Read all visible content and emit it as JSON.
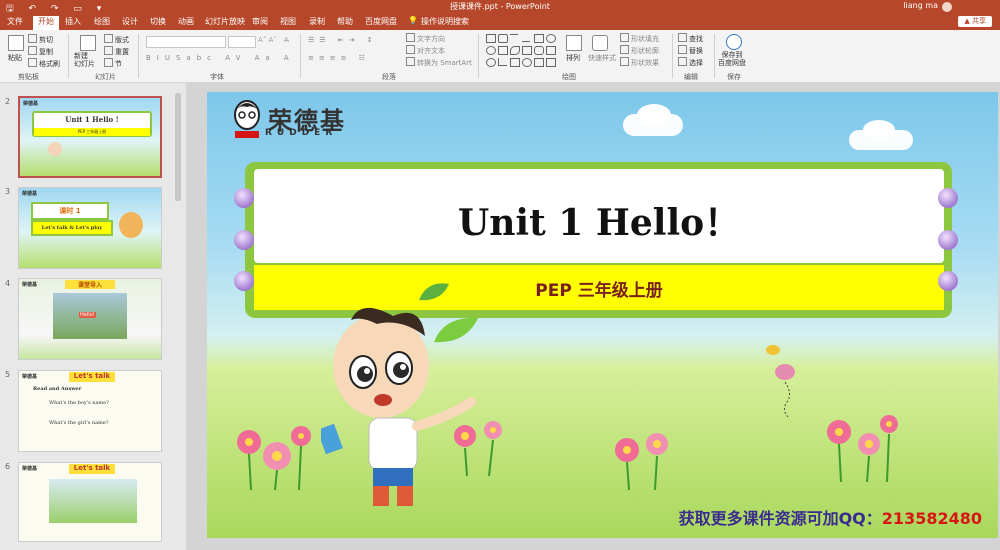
{
  "titlebar": {
    "document_title": "授课课件.ppt - PowerPoint",
    "user": "liang ma"
  },
  "menu": {
    "tabs": [
      "文件",
      "开始",
      "插入",
      "绘图",
      "设计",
      "切换",
      "动画",
      "幻灯片放映",
      "审阅",
      "视图",
      "录制",
      "帮助",
      "百度网盘",
      "操作说明搜索"
    ],
    "active_tab": "开始",
    "share_label": "▲ 共享"
  },
  "ribbon": {
    "clipboard": {
      "paste": "粘贴",
      "cut": "剪切",
      "copy": "复制",
      "format_painter": "格式刷",
      "group": "剪贴板"
    },
    "slides": {
      "new_slide": "新建\n幻灯片",
      "layout": "版式",
      "reset": "重置",
      "section": "节",
      "group": "幻灯片"
    },
    "font": {
      "group": "字体"
    },
    "paragraph": {
      "text_direction": "文字方向",
      "align_text": "对齐文本",
      "smartart": "转换为 SmartArt",
      "group": "段落"
    },
    "drawing": {
      "arrange": "排列",
      "quick_styles": "快速样式",
      "shape_fill": "形状填充",
      "shape_outline": "形状轮廓",
      "shape_effects": "形状效果",
      "group": "绘图"
    },
    "editing": {
      "find": "查找",
      "replace": "替换",
      "select": "选择",
      "group": "编辑"
    },
    "save": {
      "save_to": "保存到\n百度网盘",
      "group": "保存"
    }
  },
  "thumbnails": [
    {
      "num": "2",
      "header": "荣德基",
      "title": "Unit 1  Hello !",
      "subtitle": "PEP  三年级上册",
      "selected": true
    },
    {
      "num": "3",
      "header": "荣德基",
      "title": "课时 1",
      "subtitle": "Let's talk & Let's play",
      "selected": false
    },
    {
      "num": "4",
      "header": "荣德基",
      "title": "课堂导入",
      "subtitle": "Hello!",
      "selected": false
    },
    {
      "num": "5",
      "header": "荣德基",
      "title": "Let's talk",
      "lines": [
        "Read and Answer",
        "What's the boy's name?",
        "What's the girl's name?"
      ],
      "selected": false
    },
    {
      "num": "6",
      "header": "荣德基",
      "title": "Let's talk",
      "selected": false
    }
  ],
  "slide": {
    "logo": "荣德基",
    "logo_sub": "RUDDER",
    "title": "Unit 1  Hello！",
    "subtitle": "PEP    三年级上册",
    "promo_text": "获取更多课件资源可加QQ：",
    "promo_qq": "213582480"
  },
  "colors": {
    "accent": "#b7472a",
    "frame_green": "#8dc63f",
    "band_yellow": "#ffff00",
    "promo_blue": "#3a2c8f",
    "promo_red": "#d81515"
  }
}
